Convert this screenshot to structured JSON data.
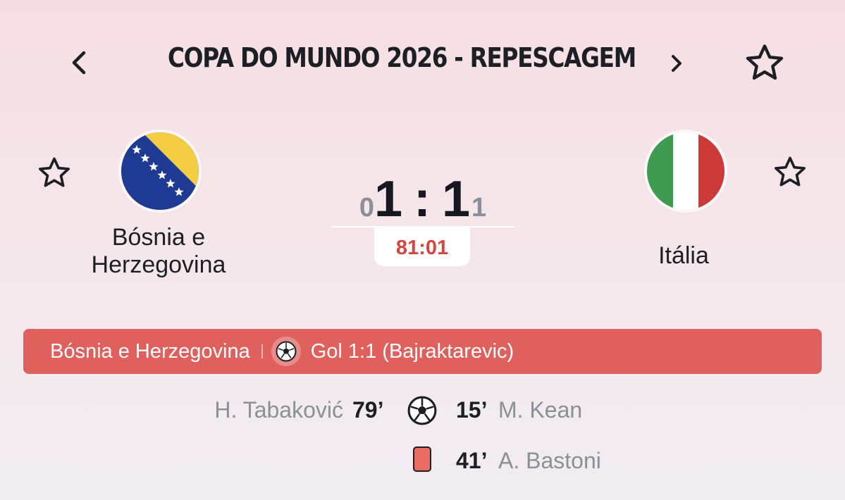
{
  "header": {
    "title": "COPA DO MUNDO 2026 - REPESCAGEM"
  },
  "home": {
    "name_line1": "Bósnia e",
    "name_line2": "Herzegovina"
  },
  "away": {
    "name": "Itália"
  },
  "score": {
    "home": "1",
    "away": "1",
    "separator": ":",
    "home_small": "0",
    "away_small": "1",
    "clock": "81:01"
  },
  "event_banner": {
    "team": "Bósnia e Herzegovina",
    "text": "Gol 1:1 (Bajraktarevic)"
  },
  "events": [
    {
      "side": "home",
      "player": "H. Tabaković",
      "minute": "79’",
      "icon": "soccer-ball-icon"
    },
    {
      "side": "away",
      "player": "M. Kean",
      "minute": "15’",
      "icon": "soccer-ball-icon"
    },
    {
      "side": "away",
      "player": "A. Bastoni",
      "minute": "41’",
      "icon": "red-card-icon"
    }
  ],
  "colors": {
    "accent_red": "#e0605d",
    "clock_red": "#d6453f",
    "bosnia_blue": "#1f3a93",
    "bosnia_yellow": "#f5cd45",
    "italy_green": "#3f9b4f",
    "italy_red": "#cd3a3a",
    "red_card": "#ea6a64"
  }
}
